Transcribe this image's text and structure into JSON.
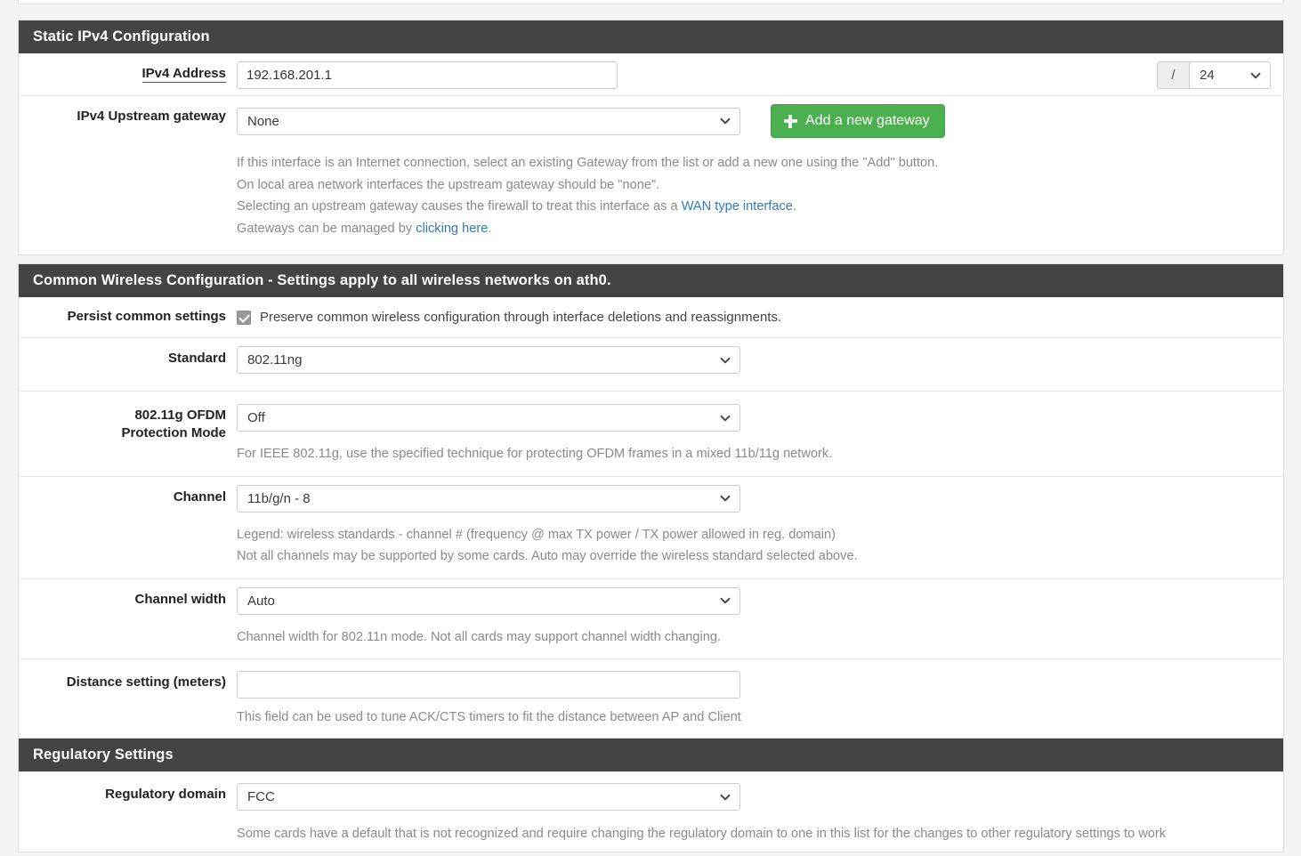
{
  "static_ipv4": {
    "heading": "Static IPv4 Configuration",
    "address": {
      "label": "IPv4 Address",
      "value": "192.168.201.1",
      "placeholder": "",
      "slash": "/",
      "mask": "24"
    },
    "gateway": {
      "label": "IPv4 Upstream gateway",
      "value": "None",
      "add_button": "Add a new gateway",
      "help_line1": "If this interface is an Internet connection, select an existing Gateway from the list or add a new one using the \"Add\" button.",
      "help_line2": "On local area network interfaces the upstream gateway should be \"none\".",
      "help_line3_pre": "Selecting an upstream gateway causes the firewall to treat this interface as a ",
      "help_line3_link": "WAN type interface",
      "help_line3_post": ".",
      "help_line4_pre": "Gateways can be managed by ",
      "help_line4_link": "clicking here",
      "help_line4_post": "."
    }
  },
  "common_wireless": {
    "heading": "Common Wireless Configuration - Settings apply to all wireless networks on ath0.",
    "persist": {
      "label": "Persist common settings",
      "checkbox_label": "Preserve common wireless configuration through interface deletions and reassignments.",
      "checked": true
    },
    "standard": {
      "label": "Standard",
      "value": "802.11ng"
    },
    "ofdm": {
      "label_line1": "802.11g OFDM",
      "label_line2": "Protection Mode",
      "value": "Off",
      "help": "For IEEE 802.11g, use the specified technique for protecting OFDM frames in a mixed 11b/11g network."
    },
    "channel": {
      "label": "Channel",
      "value": "11b/g/n - 8",
      "help_line1": "Legend: wireless standards - channel # (frequency @ max TX power / TX power allowed in reg. domain)",
      "help_line2": "Not all channels may be supported by some cards. Auto may override the wireless standard selected above."
    },
    "channel_width": {
      "label": "Channel width",
      "value": "Auto",
      "help": "Channel width for 802.11n mode. Not all cards may support channel width changing."
    },
    "distance": {
      "label": "Distance setting (meters)",
      "value": "",
      "placeholder": "",
      "help": "This field can be used to tune ACK/CTS timers to fit the distance between AP and Client"
    }
  },
  "regulatory": {
    "heading": "Regulatory Settings",
    "domain": {
      "label": "Regulatory domain",
      "value": "FCC",
      "help": "Some cards have a default that is not recognized and require changing the regulatory domain to one in this list for the changes to other regulatory settings to work"
    }
  },
  "colors": {
    "panel_heading_bg": "#444444",
    "accent_green": "#4caf50",
    "link_blue": "#337ab7"
  }
}
